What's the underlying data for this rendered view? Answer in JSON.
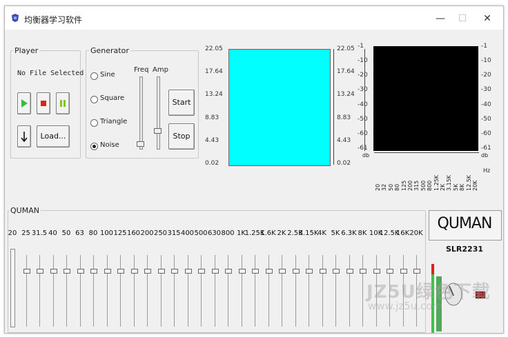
{
  "window": {
    "title": "均衡器学习软件",
    "minimize_icon": "minimize-icon",
    "maximize_icon": "maximize-icon",
    "close_icon": "close-icon",
    "minimize_glyph": "—",
    "maximize_glyph": "☐",
    "close_glyph": "✕"
  },
  "player": {
    "group_label": "Player",
    "file_status": "No File Selected",
    "play_icon": "play-icon",
    "stop_icon": "stop-icon",
    "pause_icon": "pause-icon",
    "down_icon": "down-arrow-icon",
    "load_label": "Load...",
    "colors": {
      "play": "#2fbf3a",
      "stop": "#e02020",
      "pause": "#7cc828"
    }
  },
  "generator": {
    "group_label": "Generator",
    "options": [
      "Sine",
      "Square",
      "Triangle",
      "Noise"
    ],
    "selected": "Noise",
    "freq_label": "Freq",
    "amp_label": "Amp",
    "start_label": "Start",
    "stop_label": "Stop"
  },
  "spectrum": {
    "left_axis": [
      "22.05",
      "17.64",
      "13.24",
      "8.83",
      "4.43",
      "0.02"
    ],
    "right_axis": [
      "22.05",
      "17.64",
      "13.24",
      "8.83",
      "4.43",
      "0.02"
    ],
    "color": "#00ffff"
  },
  "db_display": {
    "left_axis": [
      "-1",
      "-10",
      "-20",
      "-30",
      "-40",
      "-50",
      "-60",
      "-61"
    ],
    "right_axis": [
      "-1",
      "-10",
      "-20",
      "-30",
      "-40",
      "-50",
      "-60",
      "-61"
    ],
    "unit_left": "db",
    "unit_right": "db",
    "hz_unit": "Hz",
    "freq_labels": [
      "20",
      "32",
      "50",
      "80",
      "125",
      "200",
      "315",
      "500",
      "800",
      "1.25K",
      "2K",
      "3.15K",
      "5K",
      "8K",
      "12.5K",
      "20K"
    ],
    "color": "#000000"
  },
  "equalizer": {
    "group_label": "QUMAN",
    "bands": [
      "20",
      "25",
      "31.5",
      "40",
      "50",
      "63",
      "80",
      "100",
      "125",
      "160",
      "200",
      "250",
      "315",
      "400",
      "500",
      "630",
      "800",
      "1K",
      "1.25K",
      "1.6K",
      "2K",
      "2.5K",
      "3.15K",
      "4K",
      "5K",
      "6.3K",
      "8K",
      "10K",
      "12.5K",
      "16K",
      "20K"
    ]
  },
  "brand": {
    "name": "QUMAN",
    "model": "SLR2231"
  },
  "watermark": {
    "text": "JZ5U绿色下载",
    "url": "www.jz5u.com"
  }
}
